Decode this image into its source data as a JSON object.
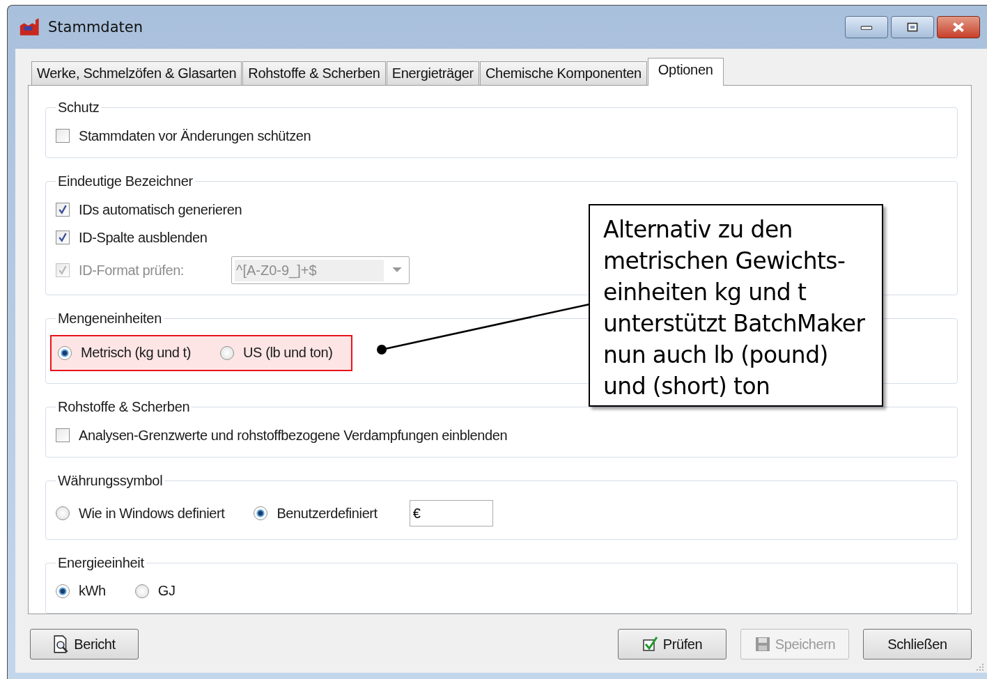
{
  "window": {
    "title": "Stammdaten"
  },
  "tabs": [
    {
      "label": "Werke, Schmelzöfen & Glasarten",
      "selected": false
    },
    {
      "label": "Rohstoffe & Scherben",
      "selected": false
    },
    {
      "label": "Energieträger",
      "selected": false
    },
    {
      "label": "Chemische Komponenten",
      "selected": false
    },
    {
      "label": "Optionen",
      "selected": true
    }
  ],
  "groups": [
    {
      "title": "Schutz",
      "rows": [
        [
          {
            "kind": "checkbox",
            "label": "Stammdaten vor Änderungen schützen",
            "checked": false,
            "disabled": false
          }
        ]
      ]
    },
    {
      "title": "Eindeutige Bezeichner",
      "rows": [
        [
          {
            "kind": "checkbox",
            "label": "IDs automatisch generieren",
            "checked": true,
            "disabled": false
          }
        ],
        [
          {
            "kind": "checkbox",
            "label": "ID-Spalte ausblenden",
            "checked": true,
            "disabled": false
          }
        ],
        [
          {
            "kind": "checkbox",
            "label": "ID-Format prüfen:",
            "checked": true,
            "disabled": true
          },
          {
            "kind": "combo",
            "value": "^[A-Z0-9_]+$",
            "disabled": true
          }
        ]
      ]
    },
    {
      "title": "Mengeneinheiten",
      "highlighted": true,
      "rows": [
        [
          {
            "kind": "radio",
            "label": "Metrisch (kg und t)",
            "selected": true
          },
          {
            "kind": "radio",
            "label": "US (lb und ton)",
            "selected": false
          }
        ]
      ]
    },
    {
      "title": "Rohstoffe & Scherben",
      "rows": [
        [
          {
            "kind": "checkbox",
            "label": "Analysen-Grenzwerte und rohstoffbezogene Verdampfungen einblenden",
            "checked": false,
            "disabled": false
          }
        ]
      ]
    },
    {
      "title": "Währungssymbol",
      "rows": [
        [
          {
            "kind": "radio",
            "label": "Wie in Windows definiert",
            "selected": false
          },
          {
            "kind": "radio",
            "label": "Benutzerdefiniert",
            "selected": true
          },
          {
            "kind": "text",
            "value": "€"
          }
        ]
      ]
    },
    {
      "title": "Energieeinheit",
      "rows": [
        [
          {
            "kind": "radio",
            "label": "kWh",
            "selected": true
          },
          {
            "kind": "radio",
            "label": "GJ",
            "selected": false
          }
        ]
      ]
    }
  ],
  "callout": {
    "lines": [
      "Alternativ zu den",
      "metrischen Gewichts-",
      "einheiten kg und t",
      "unterstützt BatchMaker",
      "nun auch lb (pound)",
      "und (short) ton"
    ]
  },
  "buttons": [
    {
      "kind": "report",
      "label": "Bericht",
      "disabled": false
    },
    {
      "kind": "check",
      "label": "Prüfen",
      "disabled": false
    },
    {
      "kind": "save",
      "label": "Speichern",
      "disabled": true
    },
    {
      "kind": "plain",
      "label": "Schließen",
      "disabled": false
    }
  ]
}
